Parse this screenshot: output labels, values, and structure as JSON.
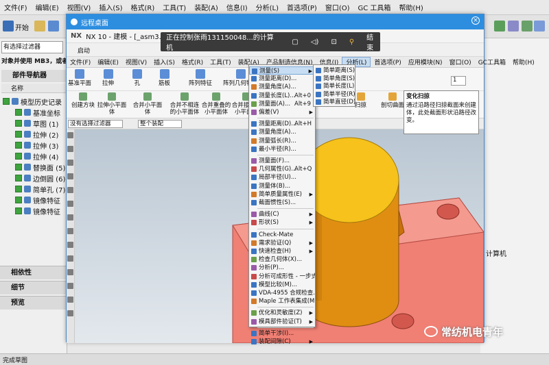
{
  "outer": {
    "menu": [
      "文件(F)",
      "编辑(E)",
      "视图(V)",
      "插入(S)",
      "格式(R)",
      "工具(T)",
      "装配(A)",
      "信息(I)",
      "分析(L)",
      "首选项(P)",
      "窗口(O)",
      "GC 工具箱",
      "帮助(H)"
    ],
    "start_label": "开始",
    "filter_label": "有选择过滤器",
    "notice_text": "对象并使用 MB3，或者",
    "navigator_title": "部件导航器",
    "col_name": "名称",
    "tree": [
      {
        "label": "模型历史记录",
        "indent": 0
      },
      {
        "label": "基准坐标",
        "indent": 1
      },
      {
        "label": "草图 (1)",
        "indent": 1
      },
      {
        "label": "拉伸 (2)",
        "indent": 1
      },
      {
        "label": "拉伸 (3)",
        "indent": 1
      },
      {
        "label": "拉伸 (4)",
        "indent": 1
      },
      {
        "label": "替换面 (5)",
        "indent": 1
      },
      {
        "label": "边倒圆 (6)",
        "indent": 1
      },
      {
        "label": "简单孔 (7)",
        "indent": 1
      },
      {
        "label": "镜像特征",
        "indent": 1
      },
      {
        "label": "镜像特征",
        "indent": 1
      }
    ],
    "sections": [
      "相依性",
      "细节",
      "预览"
    ],
    "right_text": "计算机",
    "bottom_label": "完成草图"
  },
  "remote": {
    "window_title": "远程桌面",
    "control_text": "正在控制张雨131150048...的计算机",
    "end_label": "结束",
    "nx_logo": "NX",
    "nx_title": "NX 10 - 建模 - [_asm3.prt （修改的）]",
    "qat_start": "启动",
    "menubar": [
      "文件(F)",
      "编辑(E)",
      "视图(V)",
      "插入(S)",
      "格式(R)",
      "工具(T)",
      "装配(A)",
      "产品制造信息(N)",
      "信息(I)",
      "分析(L)",
      "首选项(P)",
      "应用模块(N)",
      "窗口(O)",
      "GC工具箱",
      "帮助(H)"
    ],
    "active_menu": "分析(L)",
    "ribbon1": [
      "基准平面",
      "拉伸",
      "孔",
      "筋板",
      "阵列特征",
      "阵列几何特征"
    ],
    "ribbon2": [
      "创建方块",
      "拉伸小平面体",
      "合并小平面体",
      "合并不相连的小平面体",
      "合并重叠的小平面体",
      "合并接触的小平面体"
    ],
    "ribbon2_right": [
      "扫掠",
      "剖切曲面",
      "变化扫掠"
    ],
    "filter1": "没有选择过滤器",
    "filter2": "整个装配",
    "spin_value": "1",
    "dropdown": [
      {
        "label": "测量(S)",
        "sc": "",
        "ar": true,
        "hi": true
      },
      {
        "label": "测量距离(D)...",
        "sc": "",
        "ar": false
      },
      {
        "label": "测量角度(A)...",
        "sc": "",
        "ar": false
      },
      {
        "label": "测量长度(L)...",
        "sc": "Alt+0",
        "ar": false
      },
      {
        "label": "测量面(A)...",
        "sc": "Alt+9",
        "ar": false
      },
      {
        "label": "偏差(V)",
        "sc": "",
        "ar": true
      },
      {
        "sep": true
      },
      {
        "label": "测量距离(D)...",
        "sc": "Alt+H",
        "ar": false
      },
      {
        "label": "测量角度(A)...",
        "sc": "",
        "ar": false
      },
      {
        "label": "测量弧长(R)...",
        "sc": "",
        "ar": false
      },
      {
        "label": "最小半径(R)...",
        "sc": "",
        "ar": false
      },
      {
        "sep": true
      },
      {
        "label": "测量面(F)...",
        "sc": "",
        "ar": false
      },
      {
        "label": "几何属性(G)...",
        "sc": "Alt+Q",
        "ar": false
      },
      {
        "label": "局部半径(U)...",
        "sc": "",
        "ar": false
      },
      {
        "label": "测量体(B)...",
        "sc": "",
        "ar": false
      },
      {
        "label": "简单质量属性(E)",
        "sc": "",
        "ar": true
      },
      {
        "label": "截面惯性(S)...",
        "sc": "",
        "ar": false
      },
      {
        "sep": true
      },
      {
        "label": "曲线(C)",
        "sc": "",
        "ar": true
      },
      {
        "label": "形状(S)",
        "sc": "",
        "ar": true
      },
      {
        "sep": true
      },
      {
        "label": "Check-Mate",
        "sc": "",
        "ar": false
      },
      {
        "label": "需求验证(Q)",
        "sc": "",
        "ar": true
      },
      {
        "label": "快速检查(H)",
        "sc": "",
        "ar": true
      },
      {
        "label": "检查几何体(X)...",
        "sc": "",
        "ar": false
      },
      {
        "label": "分析(P)...",
        "sc": "",
        "ar": false
      },
      {
        "label": "分析可成形性 - 一步式(Z)...",
        "sc": "",
        "ar": false
      },
      {
        "label": "模型比较(M)...",
        "sc": "",
        "ar": false
      },
      {
        "label": "VDA-4955 合规检查...",
        "sc": "",
        "ar": false
      },
      {
        "label": "Maple 工作表集成(M)...",
        "sc": "",
        "ar": false
      },
      {
        "sep": true
      },
      {
        "label": "优化和灵敏度(Z)",
        "sc": "",
        "ar": true
      },
      {
        "label": "模具部件验证(T)",
        "sc": "",
        "ar": true
      },
      {
        "sep": true
      },
      {
        "label": "简单干涉(I)...",
        "sc": "",
        "ar": false
      },
      {
        "label": "装配间隙(C)",
        "sc": "",
        "ar": true
      }
    ],
    "submenu": [
      "简单距离(S)...",
      "简单角度(S)...",
      "简单长度(L)...",
      "简单半径(R)...",
      "简单直径(D)..."
    ],
    "tooltip_title": "变化扫掠",
    "tooltip_text": "通过沿路径扫掠截面来创建体，此处截面形状沿路径改变。"
  },
  "watermark": "常纺机电青年",
  "colors": {
    "title_blue": "#2d8ee0",
    "yellow": "#f6c21b",
    "orange": "#e98a12",
    "salmon": "#f07f74",
    "brown": "#b96b0b"
  }
}
